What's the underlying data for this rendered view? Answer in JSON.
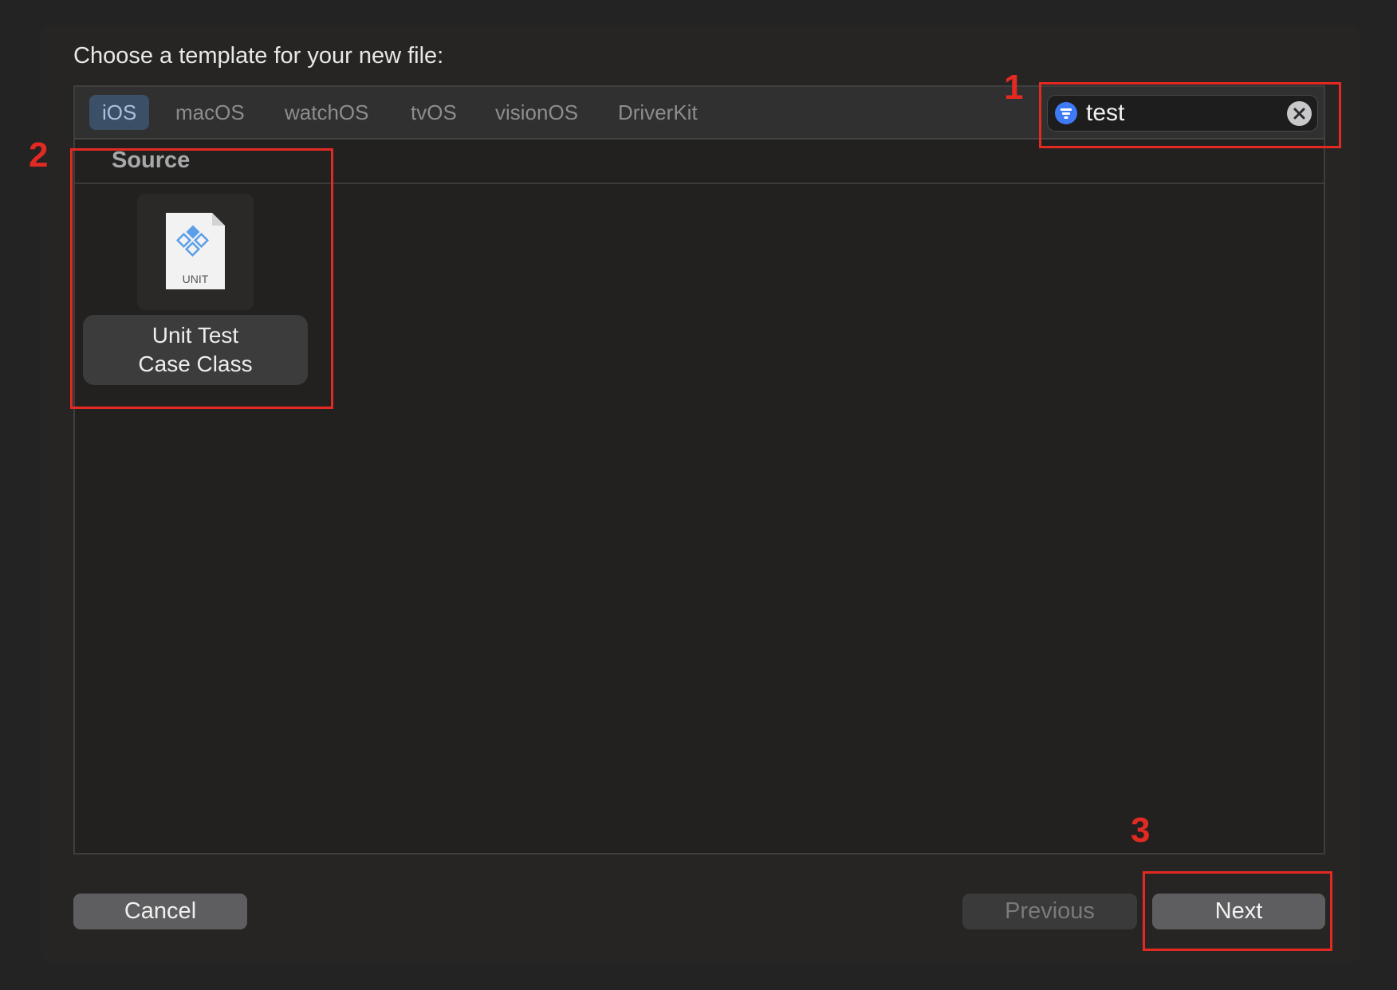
{
  "dialog": {
    "prompt": "Choose a template for your new file:"
  },
  "tabs": [
    {
      "label": "iOS",
      "selected": true
    },
    {
      "label": "macOS",
      "selected": false
    },
    {
      "label": "watchOS",
      "selected": false
    },
    {
      "label": "tvOS",
      "selected": false
    },
    {
      "label": "visionOS",
      "selected": false
    },
    {
      "label": "DriverKit",
      "selected": false
    }
  ],
  "search": {
    "value": "test",
    "filter_icon": "filter-icon",
    "clear_icon": "clear-icon"
  },
  "section": {
    "title": "Source"
  },
  "templates": [
    {
      "icon": "unit-test-file-icon",
      "icon_caption": "UNIT",
      "label_line1": "Unit Test",
      "label_line2": "Case Class"
    }
  ],
  "buttons": {
    "cancel": "Cancel",
    "previous": "Previous",
    "next": "Next"
  },
  "annotations": [
    "1",
    "2",
    "3"
  ],
  "colors": {
    "accent": "#3f7af5",
    "annotation": "#e32a22",
    "selected_tab": "#3b4f66"
  }
}
